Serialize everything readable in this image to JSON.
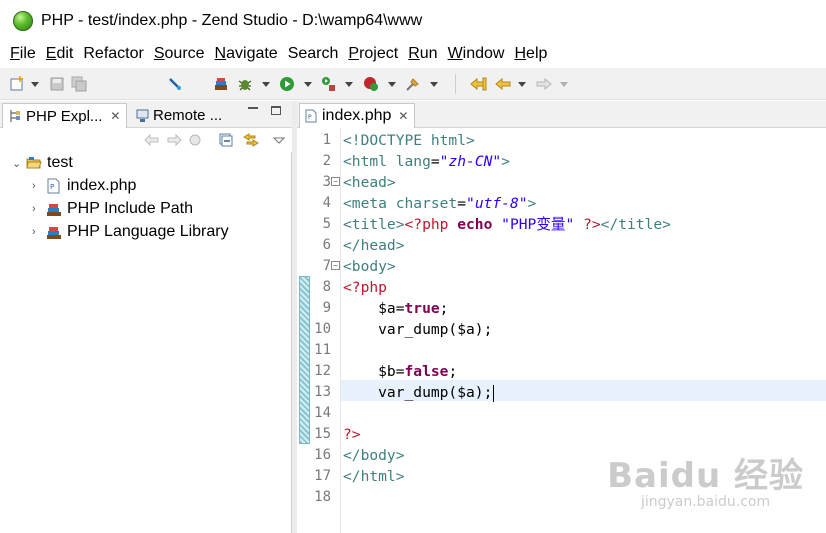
{
  "window": {
    "title": "PHP - test/index.php - Zend Studio - D:\\wamp64\\www"
  },
  "menubar": {
    "items": [
      {
        "label": "File",
        "mnemonic": "F",
        "rest": "ile"
      },
      {
        "label": "Edit",
        "mnemonic": "E",
        "rest": "dit"
      },
      {
        "label": "Refactor",
        "mnemonic": "",
        "rest": "Refactor"
      },
      {
        "label": "Source",
        "mnemonic": "S",
        "rest": "ource"
      },
      {
        "label": "Navigate",
        "mnemonic": "N",
        "rest": "avigate"
      },
      {
        "label": "Search",
        "mnemonic": "",
        "rest": "Search"
      },
      {
        "label": "Project",
        "mnemonic": "P",
        "rest": "roject"
      },
      {
        "label": "Run",
        "mnemonic": "R",
        "rest": "un"
      },
      {
        "label": "Window",
        "mnemonic": "W",
        "rest": "indow"
      },
      {
        "label": "Help",
        "mnemonic": "H",
        "rest": "elp"
      }
    ]
  },
  "toolbar": {
    "icons": [
      "new-wizard-icon",
      "save-icon",
      "save-all-icon",
      "php-debug-icon",
      "open-type-icon",
      "debug-icon",
      "run-icon",
      "external-tools-icon",
      "new-php-icon",
      "pin-icon",
      "last-edit-location-icon",
      "back-icon",
      "forward-icon"
    ]
  },
  "left_panel": {
    "tabs": [
      {
        "label": "PHP Expl...",
        "active": true
      },
      {
        "label": "Remote ...",
        "active": false
      }
    ],
    "tree": {
      "project": "test",
      "children": [
        {
          "label": "index.php",
          "icon": "php-file-icon"
        },
        {
          "label": "PHP Include Path",
          "icon": "library-icon"
        },
        {
          "label": "PHP Language Library",
          "icon": "library-icon"
        }
      ]
    }
  },
  "editor": {
    "tab": {
      "label": "index.php"
    },
    "line_numbers": [
      "1",
      "2",
      "3",
      "4",
      "5",
      "6",
      "7",
      "8",
      "9",
      "10",
      "11",
      "12",
      "13",
      "14",
      "15",
      "16",
      "17",
      "18"
    ],
    "current_line": 13,
    "code": {
      "l1_doctype": "<!DOCTYPE html>",
      "l2_open": "<html ",
      "l2_attr": "lang",
      "l2_eq": "=",
      "l2_val": "\"zh-CN\"",
      "l2_close": ">",
      "l3": "<head>",
      "l4_open": "<meta ",
      "l4_attr": "charset",
      "l4_eq": "=",
      "l4_val": "\"utf-8\"",
      "l4_close": ">",
      "l5_open": "<title>",
      "l5_php_open": "<?php ",
      "l5_echo": "echo",
      "l5_str": " \"PHP变量\" ",
      "l5_php_close": "?>",
      "l5_close": "</title>",
      "l6": "</head>",
      "l7": "<body>",
      "l8": "<?php",
      "l9_var": "    $a=",
      "l9_kw": "true",
      "l9_end": ";",
      "l10": "    var_dump($a);",
      "l12_var": "    $b=",
      "l12_kw": "false",
      "l12_end": ";",
      "l13": "    var_dump($a);",
      "l15": "?>",
      "l16": "</body>",
      "l17": "</html>"
    }
  },
  "watermark": {
    "logo": "Baidu 经验",
    "sub": "jingyan.baidu.com"
  },
  "colors": {
    "tag": "#3f7f7f",
    "attr_value": "#2a00ff",
    "php_delimiter": "#c0162e",
    "keyword": "#7f0055",
    "current_line_bg": "#e8f2fe"
  }
}
